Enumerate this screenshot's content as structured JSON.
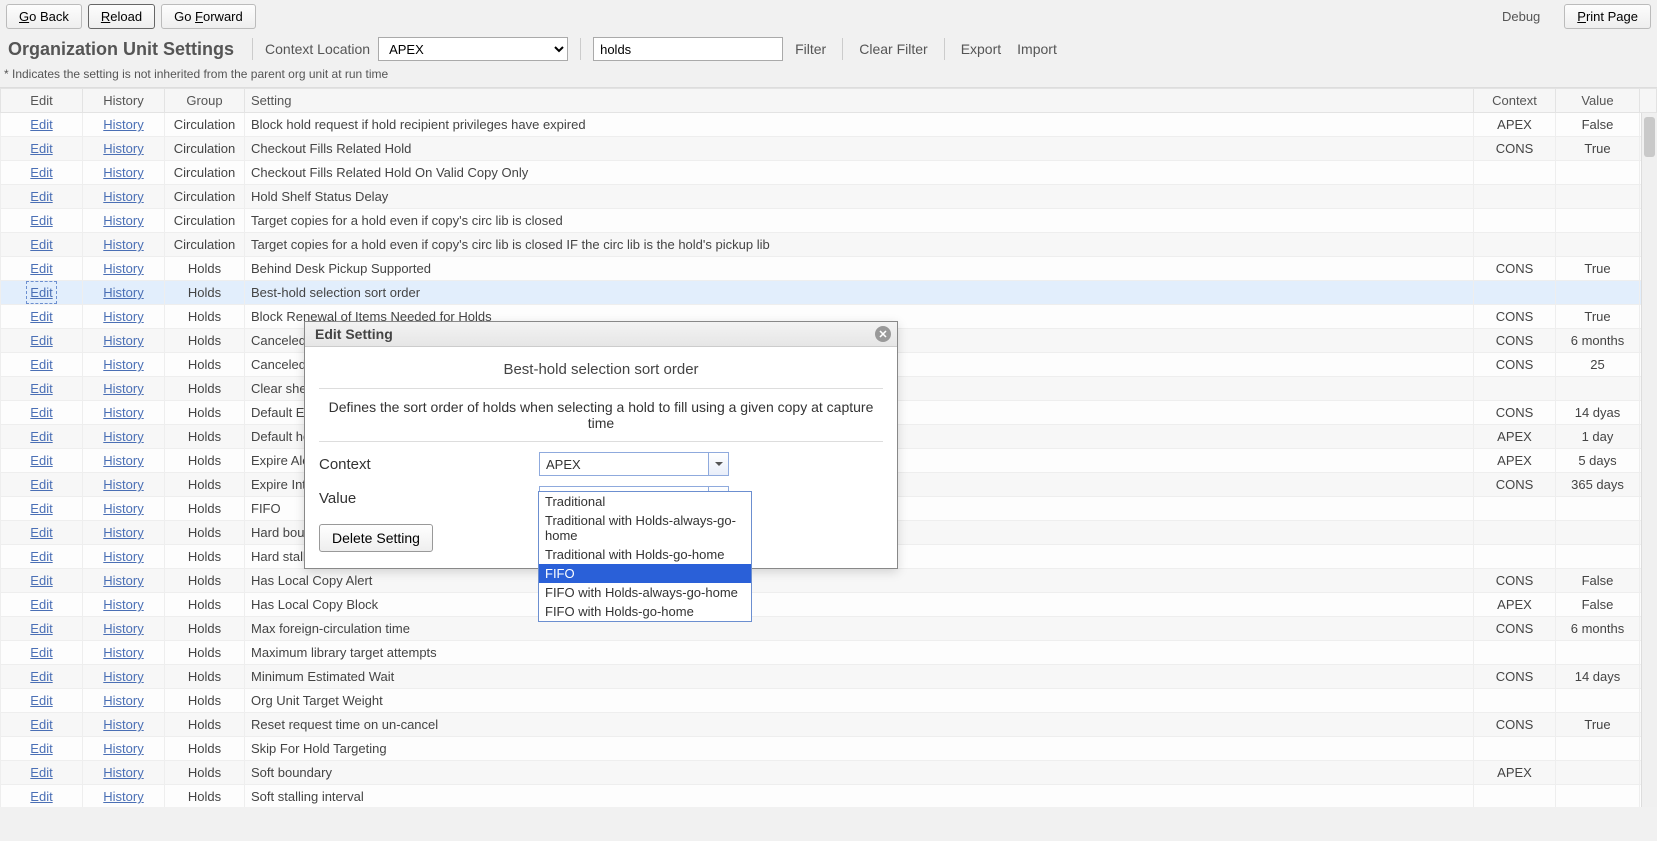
{
  "nav": {
    "go_back": "Go Back",
    "reload": "Reload",
    "go_forward": "Go Forward",
    "debug": "Debug",
    "print_page": "Print Page"
  },
  "header": {
    "title": "Organization Unit Settings",
    "context_location_label": "Context Location",
    "context_location_value": "APEX",
    "search_value": "holds",
    "filter": "Filter",
    "clear_filter": "Clear Filter",
    "export": "Export",
    "import": "Import"
  },
  "note": "*  Indicates the setting is not inherited from the parent org unit at run time",
  "columns": {
    "edit": "Edit",
    "history": "History",
    "group": "Group",
    "setting": "Setting",
    "context": "Context",
    "value": "Value"
  },
  "link_labels": {
    "edit": "Edit",
    "history": "History"
  },
  "rows": [
    {
      "group": "Circulation",
      "setting": "Block hold request if hold recipient privileges have expired",
      "context": "APEX",
      "value": "False"
    },
    {
      "group": "Circulation",
      "setting": "Checkout Fills Related Hold",
      "context": "CONS",
      "value": "True"
    },
    {
      "group": "Circulation",
      "setting": "Checkout Fills Related Hold On Valid Copy Only",
      "context": "",
      "value": ""
    },
    {
      "group": "Circulation",
      "setting": "Hold Shelf Status Delay",
      "context": "",
      "value": ""
    },
    {
      "group": "Circulation",
      "setting": "Target copies for a hold even if copy's circ lib is closed",
      "context": "",
      "value": ""
    },
    {
      "group": "Circulation",
      "setting": "Target copies for a hold even if copy's circ lib is closed IF the circ lib is the hold's pickup lib",
      "context": "",
      "value": ""
    },
    {
      "group": "Holds",
      "setting": "Behind Desk Pickup Supported",
      "context": "CONS",
      "value": "True"
    },
    {
      "group": "Holds",
      "setting": "Best-hold selection sort order",
      "context": "",
      "value": "",
      "selected": true
    },
    {
      "group": "Holds",
      "setting": "Block Renewal of Items Needed for Holds",
      "context": "CONS",
      "value": "True"
    },
    {
      "group": "Holds",
      "setting": "Canceled holds display age",
      "context": "CONS",
      "value": "6 months"
    },
    {
      "group": "Holds",
      "setting": "Canceled",
      "context": "CONS",
      "value": "25"
    },
    {
      "group": "Holds",
      "setting": "Clear she",
      "context": "",
      "value": ""
    },
    {
      "group": "Holds",
      "setting": "Default Es",
      "context": "CONS",
      "value": "14 dyas"
    },
    {
      "group": "Holds",
      "setting": "Default ho",
      "context": "APEX",
      "value": "1 day"
    },
    {
      "group": "Holds",
      "setting": "Expire Ale",
      "context": "APEX",
      "value": "5 days"
    },
    {
      "group": "Holds",
      "setting": "Expire Int",
      "context": "CONS",
      "value": "365 days"
    },
    {
      "group": "Holds",
      "setting": "FIFO",
      "context": "",
      "value": ""
    },
    {
      "group": "Holds",
      "setting": "Hard boun",
      "context": "",
      "value": ""
    },
    {
      "group": "Holds",
      "setting": "Hard stall",
      "context": "",
      "value": ""
    },
    {
      "group": "Holds",
      "setting": "Has Local Copy Alert",
      "context": "CONS",
      "value": "False"
    },
    {
      "group": "Holds",
      "setting": "Has Local Copy Block",
      "context": "APEX",
      "value": "False"
    },
    {
      "group": "Holds",
      "setting": "Max foreign-circulation time",
      "context": "CONS",
      "value": "6 months"
    },
    {
      "group": "Holds",
      "setting": "Maximum library target attempts",
      "context": "",
      "value": ""
    },
    {
      "group": "Holds",
      "setting": "Minimum Estimated Wait",
      "context": "CONS",
      "value": "14 days"
    },
    {
      "group": "Holds",
      "setting": "Org Unit Target Weight",
      "context": "",
      "value": ""
    },
    {
      "group": "Holds",
      "setting": "Reset request time on un-cancel",
      "context": "CONS",
      "value": "True"
    },
    {
      "group": "Holds",
      "setting": "Skip For Hold Targeting",
      "context": "",
      "value": ""
    },
    {
      "group": "Holds",
      "setting": "Soft boundary",
      "context": "APEX",
      "value": ""
    },
    {
      "group": "Holds",
      "setting": "Soft stalling interval",
      "context": "",
      "value": ""
    }
  ],
  "dialog": {
    "title": "Edit Setting",
    "setting_name": "Best-hold selection sort order",
    "description": "Defines the sort order of holds when selecting a hold to fill using a given copy at capture time",
    "context_label": "Context",
    "context_value": "APEX",
    "value_label": "Value",
    "value_value": "",
    "delete_label": "Delete Setting",
    "options": [
      "Traditional",
      "Traditional with Holds-always-go-home",
      "Traditional with Holds-go-home",
      "FIFO",
      "FIFO with Holds-always-go-home",
      "FIFO with Holds-go-home"
    ],
    "highlighted_index": 3
  }
}
